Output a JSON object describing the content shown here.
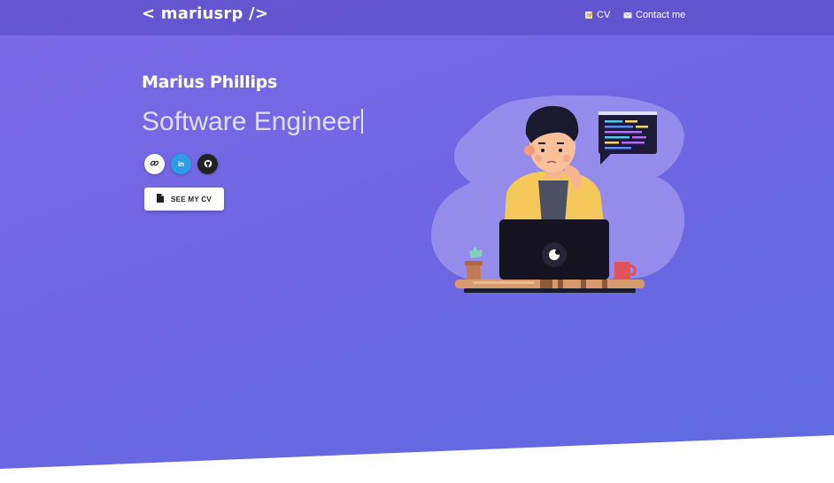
{
  "navbar": {
    "brand": "< mariusrp />",
    "links": [
      {
        "label": "CV",
        "icon": "notepad-icon"
      },
      {
        "label": "Contact me",
        "icon": "envelope-icon"
      }
    ]
  },
  "hero": {
    "name": "Marius Phillips",
    "role": "Software Engineer",
    "social": [
      {
        "icon": "link-icon"
      },
      {
        "icon": "linkedin-icon",
        "text": "in"
      },
      {
        "icon": "github-icon"
      }
    ],
    "cv_button": {
      "label": "SEE MY CV",
      "icon": "document-icon"
    }
  },
  "colors": {
    "gradient_start": "#7d6ae6",
    "gradient_end": "#5f6ae0",
    "linkedin": "#2b9fe6",
    "github": "#222222"
  }
}
